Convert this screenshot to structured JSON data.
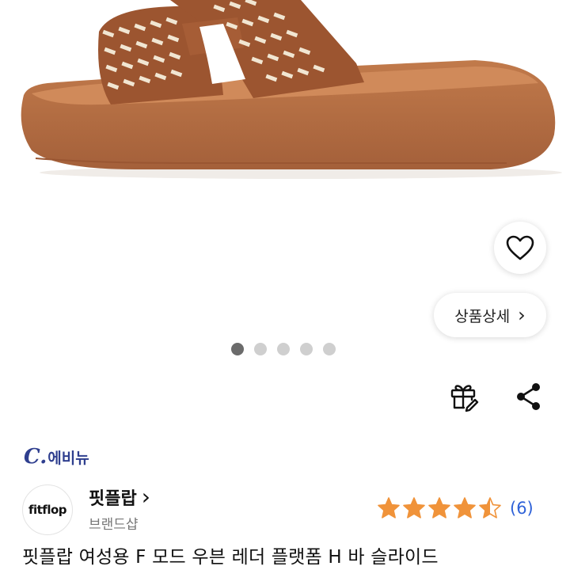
{
  "product": {
    "title": "핏플랍 여성용 F 모드 우븐 레더 플랫폼 H 바 슬라이드"
  },
  "buttons": {
    "detail_label": "상품상세",
    "detail_chevron": "›"
  },
  "carousel": {
    "total": 5,
    "active_index": 0
  },
  "seller": {
    "logo_mark": "C.",
    "name": "에비뉴"
  },
  "brand": {
    "logo_text": "fitflop",
    "name": "핏플랍",
    "name_chevron": "›",
    "subtitle": "브랜드샵"
  },
  "rating": {
    "value": 4.5,
    "max": 5,
    "review_count": "(6)"
  },
  "colors": {
    "sandal": "#b06a3e",
    "sandal_dark": "#8e4f2a",
    "weave_light": "#f1e6d2",
    "star": "#f0933a",
    "seller": "#2f3f8f",
    "link": "#2f62d8"
  },
  "icons": {
    "wishlist": "heart-icon",
    "gift": "gift-icon",
    "share": "share-icon"
  }
}
